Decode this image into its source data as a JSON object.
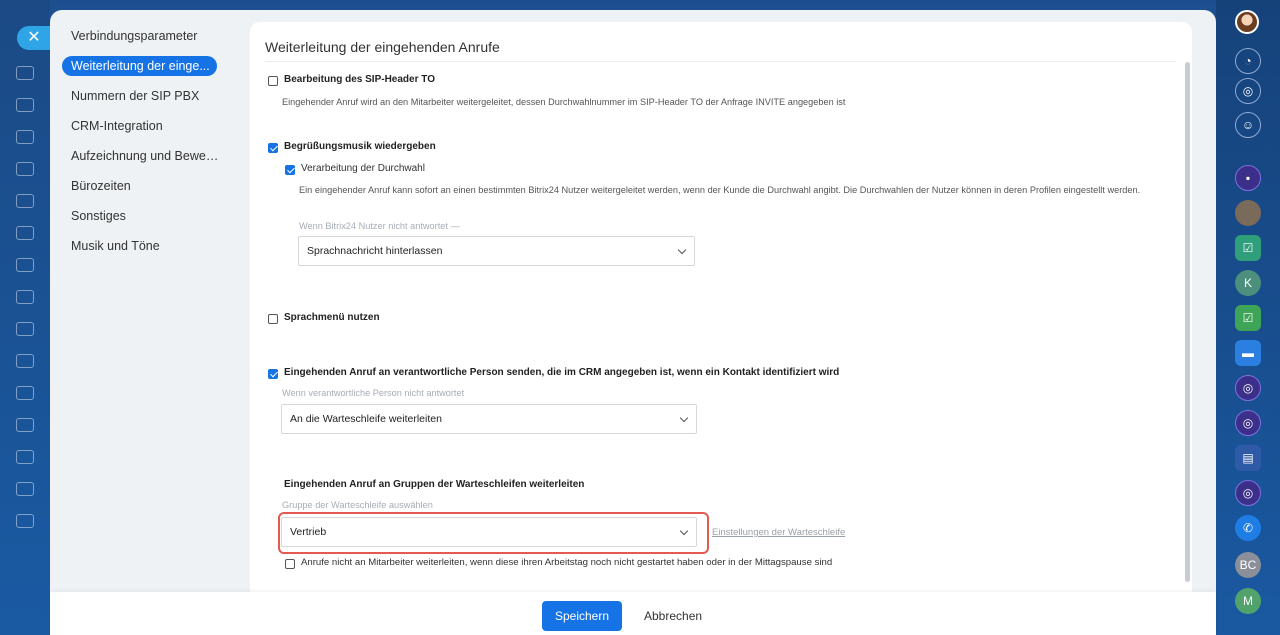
{
  "nav": {
    "items": [
      {
        "label": "Verbindungsparameter"
      },
      {
        "label": "Weiterleitung der einge..."
      },
      {
        "label": "Nummern der SIP PBX"
      },
      {
        "label": "CRM-Integration"
      },
      {
        "label": "Aufzeichnung und Bewert..."
      },
      {
        "label": "Bürozeiten"
      },
      {
        "label": "Sonstiges"
      },
      {
        "label": "Musik und Töne"
      }
    ]
  },
  "main": {
    "title": "Weiterleitung der eingehenden Anrufe",
    "sip_header": {
      "label": "Bearbeitung des SIP-Header TO",
      "checked": false,
      "description": "Eingehender Anruf wird an den Mitarbeiter weitergeleitet, dessen Durchwahlnummer im SIP-Header TO der Anfrage INVITE angegeben ist"
    },
    "greeting": {
      "label": "Begrüßungsmusik wiedergeben",
      "checked": true
    },
    "extension": {
      "label": "Verarbeitung der Durchwahl",
      "checked": true,
      "description": "Ein eingehender Anruf kann sofort an einen bestimmten Bitrix24 Nutzer weitergeleitet werden, wenn der Kunde die Durchwahl angibt. Die Durchwahlen der Nutzer können in deren Profilen eingestellt werden.",
      "hint": "Wenn Bitrix24 Nutzer nicht antwortet",
      "hint_suffix": "—",
      "select_value": "Sprachnachricht hinterlassen"
    },
    "voice_menu": {
      "label": "Sprachmenü nutzen",
      "checked": false
    },
    "crm_responsible": {
      "label": "Eingehenden Anruf an verantwortliche Person senden, die im CRM angegeben ist, wenn ein Kontakt identifiziert wird",
      "checked": true,
      "hint": "Wenn verantwortliche Person nicht antwortet",
      "select_value": "An die Warteschleife weiterleiten"
    },
    "queue_group": {
      "heading": "Eingehenden Anruf an Gruppen der Warteschleifen weiterleiten",
      "hint": "Gruppe der Warteschleife auswählen",
      "select_value": "Vertrieb",
      "settings_link": "Einstellungen der Warteschleife"
    },
    "no_forward": {
      "label": "Anrufe nicht an Mitarbeiter weiterleiten, wenn diese ihren Arbeitstag noch nicht gestartet haben oder in der Mittagspause sind",
      "checked": false
    }
  },
  "footer": {
    "save_label": "Speichern",
    "cancel_label": "Abbrechen"
  },
  "right_rail": {
    "initials_k": "K",
    "initials_bc": "BC",
    "initials_m": "M"
  },
  "colors": {
    "accent": "#1573e6",
    "highlight": "#e25a51"
  }
}
